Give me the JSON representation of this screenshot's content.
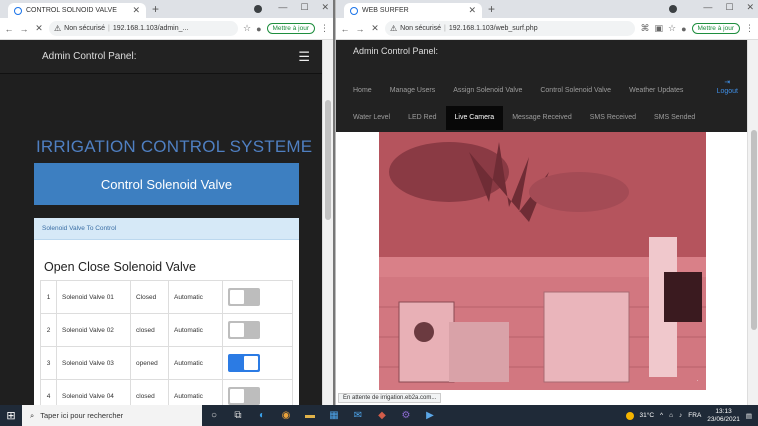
{
  "left_browser": {
    "tab_title": "CONTROL SOLNOID VALVE",
    "address_warning": "Non sécurisé",
    "address_url": "192.168.1.103/admin_...",
    "update_label": "Mettre à jour"
  },
  "left_page": {
    "navbar_title": "Admin Control Panel:",
    "system_title": "IRRIGATION CONTROL SYSTEME",
    "banner_label": "Control Solenoid Valve",
    "panel_header": "Solenoid Valve To Control",
    "panel_subtitle": "Open Close Solenoid Valve",
    "valves": [
      {
        "num": "1",
        "name": "Solenoid Valve 01",
        "status": "Closed",
        "mode": "Automatic",
        "on": false
      },
      {
        "num": "2",
        "name": "Solenoid Valve 02",
        "status": "closed",
        "mode": "Automatic",
        "on": false
      },
      {
        "num": "3",
        "name": "Solenoid Valve 03",
        "status": "opened",
        "mode": "Automatic",
        "on": true
      },
      {
        "num": "4",
        "name": "Solenoid Valve 04",
        "status": "closed",
        "mode": "Automatic",
        "on": false
      }
    ]
  },
  "right_browser": {
    "tab_title": "WEB SURFER",
    "address_warning": "Non sécurisé",
    "address_url": "192.168.1.103/web_surf.php",
    "update_label": "Mettre à jour"
  },
  "right_page": {
    "navbar_title": "Admin Control Panel:",
    "nav_row1": [
      "Home",
      "Manage Users",
      "Assign Solenoid Valve",
      "Control Solenoid Valve",
      "Weather Updates"
    ],
    "nav_row2": [
      "Water Level",
      "LED Red",
      "Live Camera",
      "Message Received",
      "SMS Received",
      "SMS Sended"
    ],
    "active_nav": "Live Camera",
    "logout_label": "Logout",
    "status_text": "En attente de irrigation.eb2a.com..."
  },
  "taskbar": {
    "search_placeholder": "Taper ici pour rechercher",
    "temperature": "31°C",
    "language": "FRA",
    "time": "13:13",
    "date": "23/06/2021"
  },
  "colors": {
    "accent_blue": "#3d7fc1",
    "toggle_on": "#2b7be4",
    "navbar_dark": "#222222"
  }
}
